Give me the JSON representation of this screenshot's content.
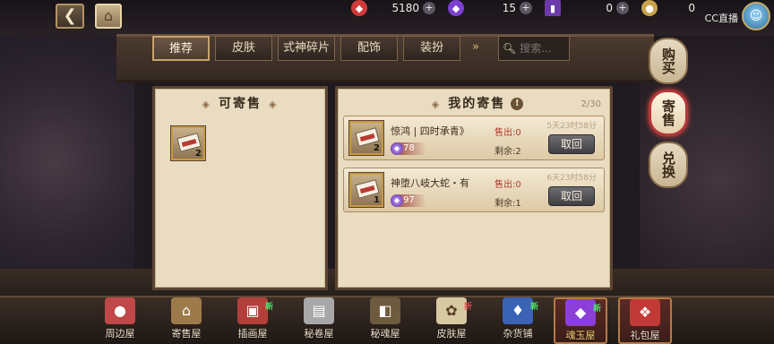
{
  "header": {
    "back_icon": "back-arrow-icon",
    "home_icon": "home-icon",
    "resources": [
      {
        "name": "red-currency",
        "value": "5180",
        "color": "#d13a3a"
      },
      {
        "name": "purple-jade",
        "value": "15",
        "color": "#7b3fd1"
      },
      {
        "name": "ticket",
        "value": "0",
        "color": "#6b3aa8"
      },
      {
        "name": "coin",
        "value": "0",
        "color": "#c9a24c"
      }
    ],
    "cc_logo": "CC直播"
  },
  "tabs": [
    {
      "label": "推荐",
      "active": true
    },
    {
      "label": "皮肤",
      "active": false
    },
    {
      "label": "式神碎片",
      "active": false
    },
    {
      "label": "配饰",
      "active": false
    },
    {
      "label": "装扮",
      "active": false
    }
  ],
  "tab_more": "»",
  "search": {
    "placeholder": "搜索..."
  },
  "left_panel": {
    "title": "可寄售",
    "items": [
      {
        "qty": "2"
      }
    ]
  },
  "right_panel": {
    "title": "我的寄售",
    "info": "!",
    "count": "2/30",
    "listings": [
      {
        "name": "惊鸿 | 四时承青》",
        "qty": "2",
        "price": "78",
        "sold": "售出:0",
        "remain": "剩余:2",
        "timer": "5天23时58分",
        "cancel_label": "取回"
      },
      {
        "name": "神堕八岐大蛇・有",
        "qty": "1",
        "price": "97",
        "sold": "售出:0",
        "remain": "剩余:1",
        "timer": "6天23时58分",
        "cancel_label": "取回"
      }
    ]
  },
  "side_buttons": [
    {
      "label": "购买",
      "active": false
    },
    {
      "label": "寄售",
      "active": true
    },
    {
      "label": "兑换",
      "active": false
    }
  ],
  "bottom_nav": [
    {
      "label": "周边屋",
      "icon": "daruma-icon",
      "color": "#c04848",
      "badge": ""
    },
    {
      "label": "寄售屋",
      "icon": "stall-icon",
      "color": "#9c7a4a",
      "badge": ""
    },
    {
      "label": "插画屋",
      "icon": "painting-icon",
      "color": "#b43f3a",
      "badge": "新"
    },
    {
      "label": "秘卷屋",
      "icon": "scroll-icon",
      "color": "#a8a8a8",
      "badge": ""
    },
    {
      "label": "秘魂屋",
      "icon": "soul-box-icon",
      "color": "#6e5a3e",
      "badge": ""
    },
    {
      "label": "皮肤屋",
      "icon": "skin-icon",
      "color": "#d7c9a2",
      "badge": "折"
    },
    {
      "label": "杂货铺",
      "icon": "pouch-icon",
      "color": "#3a62b5",
      "badge": "新"
    },
    {
      "label": "魂玉屋",
      "icon": "jade-icon",
      "color": "#8b3fd8",
      "badge": "新",
      "active": true
    },
    {
      "label": "礼包屋",
      "icon": "gift-icon",
      "color": "#c23a36",
      "badge": ""
    }
  ]
}
